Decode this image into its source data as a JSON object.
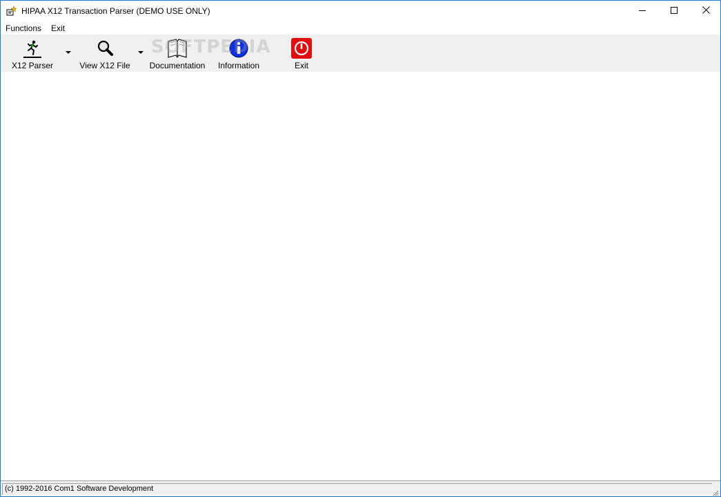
{
  "window": {
    "title": "HIPAA X12 Transaction Parser  (DEMO USE ONLY)",
    "icon": "app-icon",
    "controls": {
      "minimize": "minimize-icon",
      "maximize": "maximize-icon",
      "close": "close-icon"
    }
  },
  "menubar": {
    "items": [
      {
        "label": "Functions"
      },
      {
        "label": "Exit"
      }
    ]
  },
  "toolbar": {
    "watermark": "SOFTPEDIA",
    "buttons": [
      {
        "label": "X12 Parser",
        "icon": "running-man-icon",
        "has_dropdown": true
      },
      {
        "label": "View X12 File",
        "icon": "magnifier-icon",
        "has_dropdown": true
      },
      {
        "label": "Documentation",
        "icon": "book-icon",
        "has_dropdown": false
      },
      {
        "label": "Information",
        "icon": "info-icon",
        "has_dropdown": false
      },
      {
        "label": "Exit",
        "icon": "power-icon",
        "has_dropdown": false
      }
    ]
  },
  "statusbar": {
    "text": "(c) 1992-2016 Com1 Software Development"
  },
  "colors": {
    "window_border": "#1e7ad0",
    "toolbar_bg": "#f0f0f0",
    "info_blue": "#1030e0",
    "exit_red": "#e01010"
  }
}
